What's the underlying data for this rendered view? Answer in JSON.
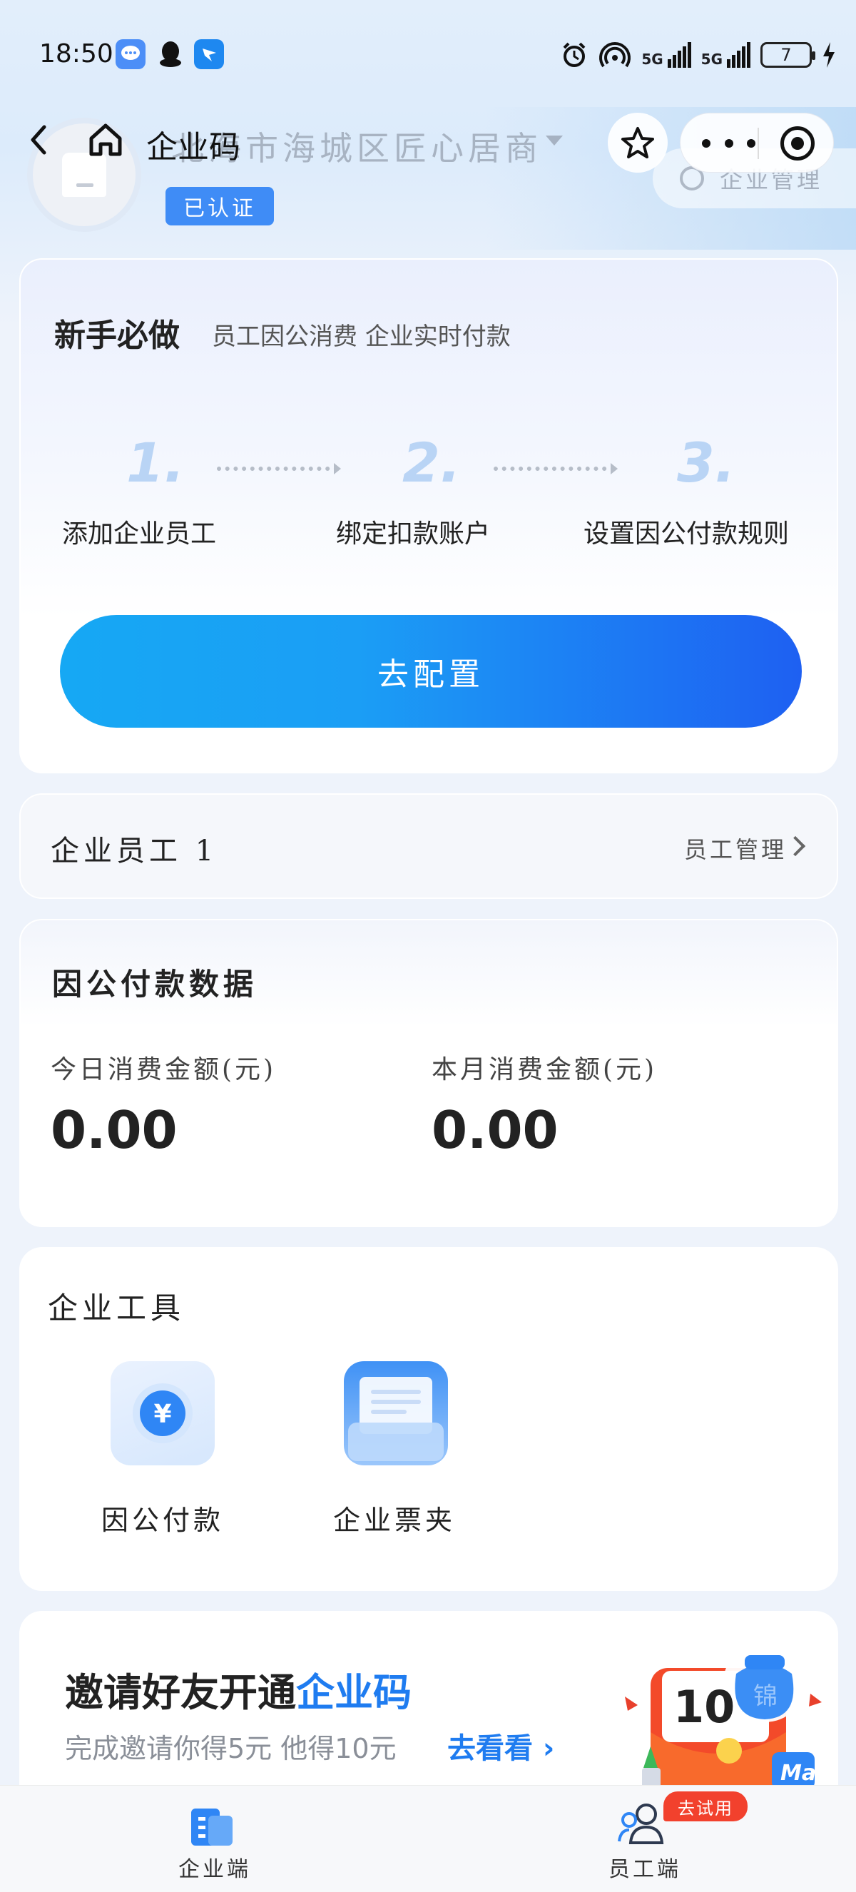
{
  "status_bar": {
    "time": "18:50",
    "battery": "7",
    "signal_1": "5G",
    "signal_2": "5G"
  },
  "nav": {
    "title": "企业码",
    "company_name": "北海市海城区匠心居商"
  },
  "company": {
    "verified_label": "已认证",
    "management_label": "企业管理"
  },
  "onboarding": {
    "title": "新手必做",
    "subtitle": "员工因公消费 企业实时付款",
    "steps": [
      {
        "num": "1.",
        "label": "添加企业员工"
      },
      {
        "num": "2.",
        "label": "绑定扣款账户"
      },
      {
        "num": "3.",
        "label": "设置因公付款规则"
      }
    ],
    "button_label": "去配置"
  },
  "employees": {
    "label": "企业员工 1",
    "manage_label": "员工管理"
  },
  "payment_data": {
    "title": "因公付款数据",
    "today_label": "今日消费金额(元)",
    "today_value": "0.00",
    "month_label": "本月消费金额(元)",
    "month_value": "0.00"
  },
  "tools": {
    "title": "企业工具",
    "items": [
      {
        "label": "因公付款",
        "icon": "yuan-coin-icon"
      },
      {
        "label": "企业票夹",
        "icon": "ticket-folder-icon"
      }
    ]
  },
  "invite": {
    "title_prefix": "邀请好友开通",
    "title_highlight": "企业码",
    "subtitle": "完成邀请你得5元 他得10元",
    "link_label": "去看看",
    "promo_number": "10",
    "bag_char": "锦",
    "badge": "Ma"
  },
  "tabbar": {
    "items": [
      {
        "label": "企业端",
        "active": true
      },
      {
        "label": "员工端",
        "active": false
      }
    ],
    "trial_badge": "去试用"
  },
  "colors": {
    "accent_blue": "#1f7cf0",
    "button_start": "#16a8f4",
    "button_end": "#1e60f2",
    "badge_red": "#f2412d"
  }
}
